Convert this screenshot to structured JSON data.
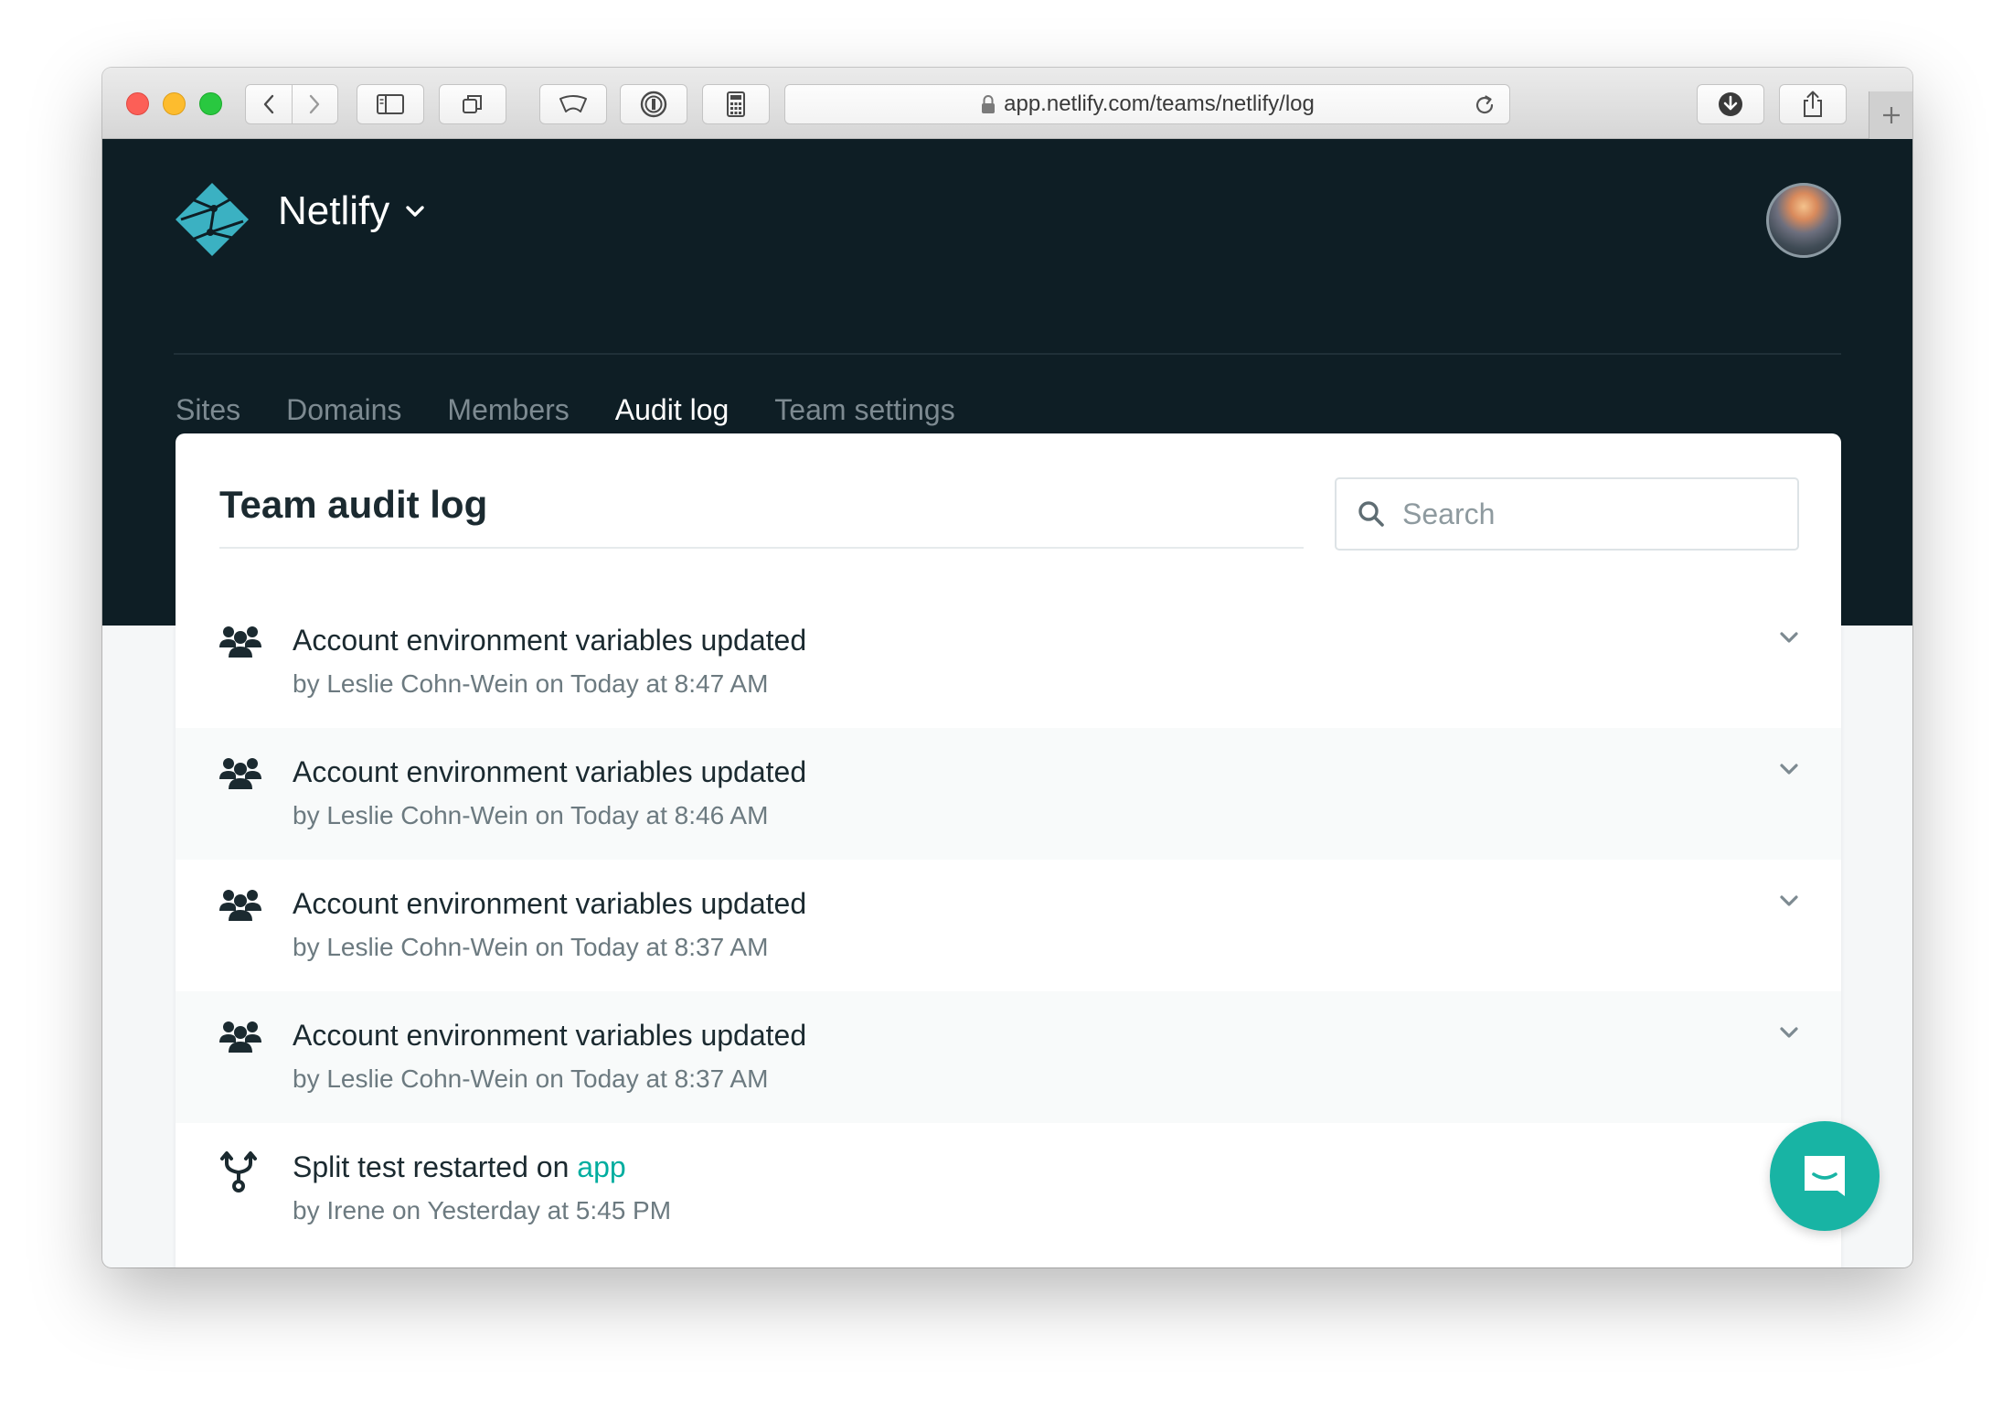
{
  "browser": {
    "url": "app.netlify.com/teams/netlify/log"
  },
  "header": {
    "team_name": "Netlify",
    "tabs": [
      {
        "label": "Sites",
        "active": false
      },
      {
        "label": "Domains",
        "active": false
      },
      {
        "label": "Members",
        "active": false
      },
      {
        "label": "Audit log",
        "active": true
      },
      {
        "label": "Team settings",
        "active": false
      }
    ]
  },
  "audit_log": {
    "title": "Team audit log",
    "search_placeholder": "Search",
    "entries": [
      {
        "icon": "team-icon",
        "title": "Account environment variables updated",
        "meta": "by Leslie Cohn-Wein on Today at 8:47 AM"
      },
      {
        "icon": "team-icon",
        "title": "Account environment variables updated",
        "meta": "by Leslie Cohn-Wein on Today at 8:46 AM"
      },
      {
        "icon": "team-icon",
        "title": "Account environment variables updated",
        "meta": "by Leslie Cohn-Wein on Today at 8:37 AM"
      },
      {
        "icon": "team-icon",
        "title": "Account environment variables updated",
        "meta": "by Leslie Cohn-Wein on Today at 8:37 AM"
      },
      {
        "icon": "split-test-icon",
        "title": "Split test restarted on",
        "link": "app",
        "meta": "by Irene on Yesterday at 5:45 PM"
      }
    ]
  },
  "colors": {
    "header_bg": "#0e1e25",
    "accent": "#00ad9f",
    "chat_button": "#18b4a4"
  }
}
